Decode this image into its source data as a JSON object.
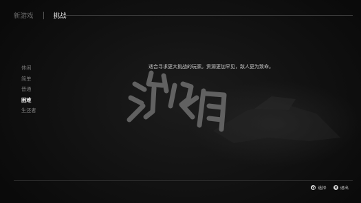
{
  "header": {
    "breadcrumb_previous": "新游戏",
    "breadcrumb_current": "挑战"
  },
  "difficulty_menu": {
    "items": [
      {
        "label": "休闲"
      },
      {
        "label": "简单"
      },
      {
        "label": "普通"
      },
      {
        "label": "困难"
      },
      {
        "label": "生还者"
      }
    ],
    "selected_index": 3
  },
  "description": "适合寻求更大挑战的玩家。资源更加罕见，敌人更为致命。",
  "watermark": {
    "text": "游侠网"
  },
  "footer": {
    "select": {
      "icon": "circle-button-icon",
      "label": "选择"
    },
    "back": {
      "icon": "cross-button-icon",
      "label": "退出"
    }
  }
}
